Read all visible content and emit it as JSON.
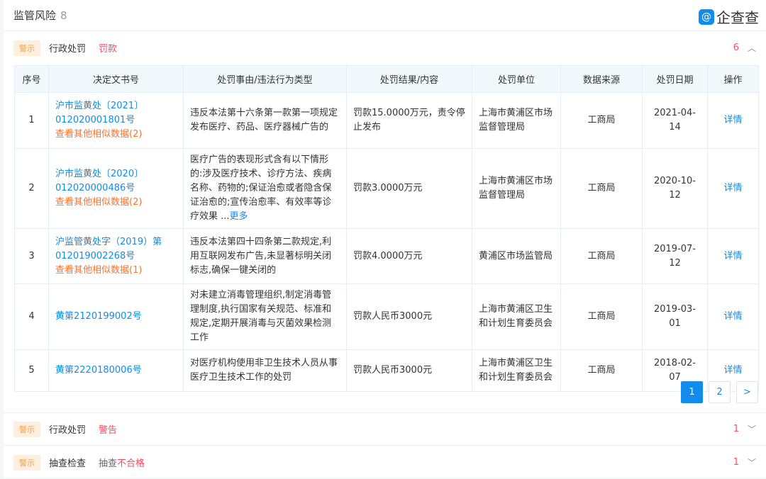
{
  "header": {
    "title": "监管风险",
    "count": "8",
    "logo_text": "企查查"
  },
  "sections": [
    {
      "badge": "警示",
      "category": "行政处罚",
      "subtype": "罚款",
      "count": "6",
      "expanded": true
    },
    {
      "badge": "警示",
      "category": "行政处罚",
      "subtype": "警告",
      "count": "1",
      "expanded": false
    },
    {
      "badge": "警示",
      "category": "抽查检查",
      "subtype_prefix": "抽查",
      "subtype": "不合格",
      "count": "1",
      "expanded": false
    }
  ],
  "table": {
    "columns": [
      "序号",
      "决定文书号",
      "处罚事由/违法行为类型",
      "处罚结果/内容",
      "处罚单位",
      "数据来源",
      "处罚日期",
      "操作"
    ],
    "rows": [
      {
        "no": "1",
        "doc": "沪市监黄处〔2021〕012020001801号",
        "similar": "查看其他相似数据(2)",
        "reason": "违反本法第十六条第一款第一项规定发布医疗、药品、医疗器械广告的",
        "more": "",
        "result": "罚款15.0000万元，责令停止发布",
        "unit": "上海市黄浦区市场监督管理局",
        "source": "工商局",
        "date": "2021-04-14",
        "action": "详情"
      },
      {
        "no": "2",
        "doc": "沪市监黄处〔2020〕012020000486号",
        "similar": "查看其他相似数据(2)",
        "reason": "医疗广告的表现形式含有以下情形的:涉及医疗技术、诊疗方法、疾病名称、药物的;保证治愈或者隐含保证治愈的;宣传治愈率、有效率等诊疗效果 ...",
        "more": "更多",
        "result": "罚款3.0000万元",
        "unit": "上海市黄浦区市场监督管理局",
        "source": "工商局",
        "date": "2020-10-12",
        "action": "详情"
      },
      {
        "no": "3",
        "doc": "沪监管黄处字（2019）第012019002268号",
        "similar": "查看其他相似数据(1)",
        "reason": "违反本法第四十四条第二款规定,利用互联网发布广告,未显著标明关闭标志,确保一键关闭的",
        "more": "",
        "result": "罚款4.0000万元",
        "unit": "黄浦区市场监管局",
        "source": "工商局",
        "date": "2019-07-12",
        "action": "详情"
      },
      {
        "no": "4",
        "doc": "黄第2120199002号",
        "similar": "",
        "reason": "对未建立消毒管理组织,制定消毒管理制度,执行国家有关规范、标准和规定,定期开展消毒与灭菌效果检测工作",
        "more": "",
        "result": "罚款人民币3000元",
        "unit": "上海市黄浦区卫生和计划生育委员会",
        "source": "工商局",
        "date": "2019-03-01",
        "action": "详情"
      },
      {
        "no": "5",
        "doc": "黄第2220180006号",
        "similar": "",
        "reason": "对医疗机构使用非卫生技术人员从事医疗卫生技术工作的处罚",
        "more": "",
        "result": "罚款人民币3000元",
        "unit": "上海市黄浦区卫生和计划生育委员会",
        "source": "工商局",
        "date": "2018-02-07",
        "action": "详情"
      }
    ]
  },
  "pagination": {
    "pages": [
      "1",
      "2"
    ],
    "current": "1",
    "next": ">"
  }
}
